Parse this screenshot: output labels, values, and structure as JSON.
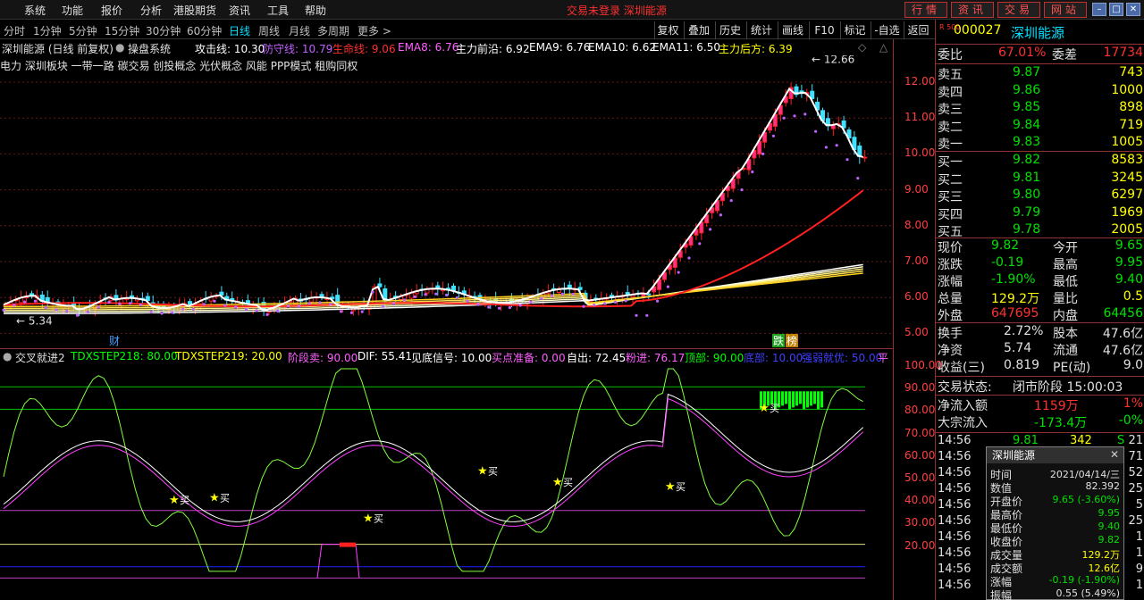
{
  "menu": [
    "系统",
    "功能",
    "报价",
    "分析",
    "港股期货",
    "资讯",
    "工具",
    "帮助"
  ],
  "notice": "交易未登录  深圳能源",
  "top_buttons": [
    "行情",
    "资讯",
    "交易",
    "网站"
  ],
  "periods": [
    "分时",
    "1分钟",
    "5分钟",
    "15分钟",
    "30分钟",
    "60分钟",
    "日线",
    "周线",
    "月线",
    "多周期",
    "更多 >"
  ],
  "right_tools": [
    "复权",
    "叠加",
    "历史",
    "统计",
    "画线",
    "F10",
    "标记",
    "-自选",
    "返回"
  ],
  "chart_title": {
    "name": "深圳能源 (日线 前复权)",
    "system": "操盘系统",
    "items": [
      {
        "text": "攻击线: 10.30",
        "color": "#ffffff"
      },
      {
        "text": "防守线: 10.79",
        "color": "#c060ff"
      },
      {
        "text": "生命线: 9.06",
        "color": "#ff3030"
      },
      {
        "text": "EMA8: 6.76",
        "color": "#ff60ff"
      },
      {
        "text": "主力前沿: 6.92",
        "color": "#ffffff"
      },
      {
        "text": "EMA9: 6.76",
        "color": "#ffffff"
      },
      {
        "text": "EMA10: 6.62",
        "color": "#ffffff"
      },
      {
        "text": "EMA11: 6.50",
        "color": "#ffffff"
      },
      {
        "text": "主力后方: 6.39",
        "color": "#ffff00"
      }
    ]
  },
  "concepts": "电力      深圳板块 一带一路 碳交易 创投概念 光伏概念 风能 PPP模式 租购同权",
  "main_axis": [
    "12.00",
    "11.00",
    "10.00",
    "9.00",
    "8.00",
    "7.00",
    "6.00",
    "5.00"
  ],
  "main_annotations": {
    "high": "12.66",
    "low": "5.34",
    "cai": "财",
    "die": "跌",
    "bang": "榜"
  },
  "indicator_title": {
    "name": "交叉就进2",
    "items": [
      {
        "text": "TDXSTEP218: 80.00",
        "color": "#00ff00"
      },
      {
        "text": "TDXSTEP219: 20.00",
        "color": "#ffff00"
      },
      {
        "text": "阶段卖: 90.00",
        "color": "#ff60ff"
      },
      {
        "text": "DIF: 55.41",
        "color": "#ffffff"
      },
      {
        "text": "见底信号: 10.00",
        "color": "#ffffff"
      },
      {
        "text": "买点准备: 0.00",
        "color": "#ff60ff"
      },
      {
        "text": "自出: 72.45",
        "color": "#ffffff"
      },
      {
        "text": "粉进: 76.17",
        "color": "#ff60ff"
      },
      {
        "text": "顶部: 90.00",
        "color": "#00ff00"
      },
      {
        "text": "底部: 10.00",
        "color": "#4040ff"
      },
      {
        "text": "强弱就优: 50.00",
        "color": "#4040ff"
      },
      {
        "text": "平",
        "color": "#ff60ff"
      }
    ]
  },
  "ind_axis": [
    "100.00",
    "90.00",
    "80.00",
    "70.00",
    "60.00",
    "50.00",
    "40.00",
    "30.00",
    "20.00"
  ],
  "buy_label": "买",
  "quote": {
    "code": "000027",
    "name": "深圳能源",
    "r500": "R 500",
    "weibi_label": "委比",
    "weibi": "67.01%",
    "weicha_label": "委差",
    "weicha": "17734",
    "asks": [
      {
        "label": "卖五",
        "price": "9.87",
        "vol": "743"
      },
      {
        "label": "卖四",
        "price": "9.86",
        "vol": "1000"
      },
      {
        "label": "卖三",
        "price": "9.85",
        "vol": "898"
      },
      {
        "label": "卖二",
        "price": "9.84",
        "vol": "719"
      },
      {
        "label": "卖一",
        "price": "9.83",
        "vol": "1005"
      }
    ],
    "bids": [
      {
        "label": "买一",
        "price": "9.82",
        "vol": "8583"
      },
      {
        "label": "买二",
        "price": "9.81",
        "vol": "3245"
      },
      {
        "label": "买三",
        "price": "9.80",
        "vol": "6297"
      },
      {
        "label": "买四",
        "price": "9.79",
        "vol": "1969"
      },
      {
        "label": "买五",
        "price": "9.78",
        "vol": "2005"
      }
    ],
    "stats": [
      {
        "l1": "现价",
        "v1": "9.82",
        "c1": "#00e000",
        "l2": "今开",
        "v2": "9.65",
        "c2": "#00e000"
      },
      {
        "l1": "涨跌",
        "v1": "-0.19",
        "c1": "#00e000",
        "l2": "最高",
        "v2": "9.95",
        "c2": "#00e000"
      },
      {
        "l1": "涨幅",
        "v1": "-1.90%",
        "c1": "#00e000",
        "l2": "最低",
        "v2": "9.40",
        "c2": "#00e000"
      },
      {
        "l1": "总量",
        "v1": "129.2万",
        "c1": "#ffff00",
        "l2": "量比",
        "v2": "0.5",
        "c2": "#ffff00"
      },
      {
        "l1": "外盘",
        "v1": "647695",
        "c1": "#ff3030",
        "l2": "内盘",
        "v2": "64456",
        "c2": "#00e000"
      }
    ],
    "stats2": [
      {
        "l1": "换手",
        "v1": "2.72%",
        "l2": "股本",
        "v2": "47.6亿"
      },
      {
        "l1": "净资",
        "v1": "5.74",
        "l2": "流通",
        "v2": "47.6亿"
      },
      {
        "l1": "收益(三)",
        "v1": "0.819",
        "l2": "PE(动)",
        "v2": "9.0"
      }
    ],
    "status_label": "交易状态:",
    "status": "闭市阶段 15:00:03",
    "netflow_label": "净流入额",
    "netflow": "1159万",
    "netflow_pct": "1%",
    "bulk_label": "大宗流入",
    "bulk": "-173.4万",
    "bulk_pct": "-0%",
    "ticks": [
      {
        "time": "14:56",
        "price": "9.81",
        "vol": "342",
        "bs": "S",
        "n": "21"
      },
      {
        "time": "14:56",
        "n": "71"
      },
      {
        "time": "14:56",
        "n": "52"
      },
      {
        "time": "14:56",
        "n": "25"
      },
      {
        "time": "14:56",
        "n": "5"
      },
      {
        "time": "14:56",
        "n": "25"
      },
      {
        "time": "14:56",
        "n": "1"
      },
      {
        "time": "14:56",
        "n": "1"
      },
      {
        "time": "14:56",
        "n": "9"
      },
      {
        "time": "14:56",
        "n": "1"
      }
    ]
  },
  "popup": {
    "title": "深圳能源",
    "rows": [
      {
        "label": "时间",
        "value": "2021/04/14/三",
        "color": "#e0e0e0"
      },
      {
        "label": "数值",
        "value": "82.392",
        "color": "#e0e0e0"
      },
      {
        "label": "开盘价",
        "value": "9.65 (-3.60%)",
        "color": "#00e000"
      },
      {
        "label": "最高价",
        "value": "9.95",
        "color": "#00e000"
      },
      {
        "label": "最低价",
        "value": "9.40",
        "color": "#00e000"
      },
      {
        "label": "收盘价",
        "value": "9.82",
        "color": "#00e000"
      },
      {
        "label": "成交量",
        "value": "129.2万",
        "color": "#ffff00"
      },
      {
        "label": "成交额",
        "value": "12.6亿",
        "color": "#ffff00"
      },
      {
        "label": "涨幅",
        "value": "-0.19 (-1.90%)",
        "color": "#00e000"
      },
      {
        "label": "振幅",
        "value": "0.55 (5.49%)",
        "color": "#e0e0e0"
      }
    ]
  }
}
